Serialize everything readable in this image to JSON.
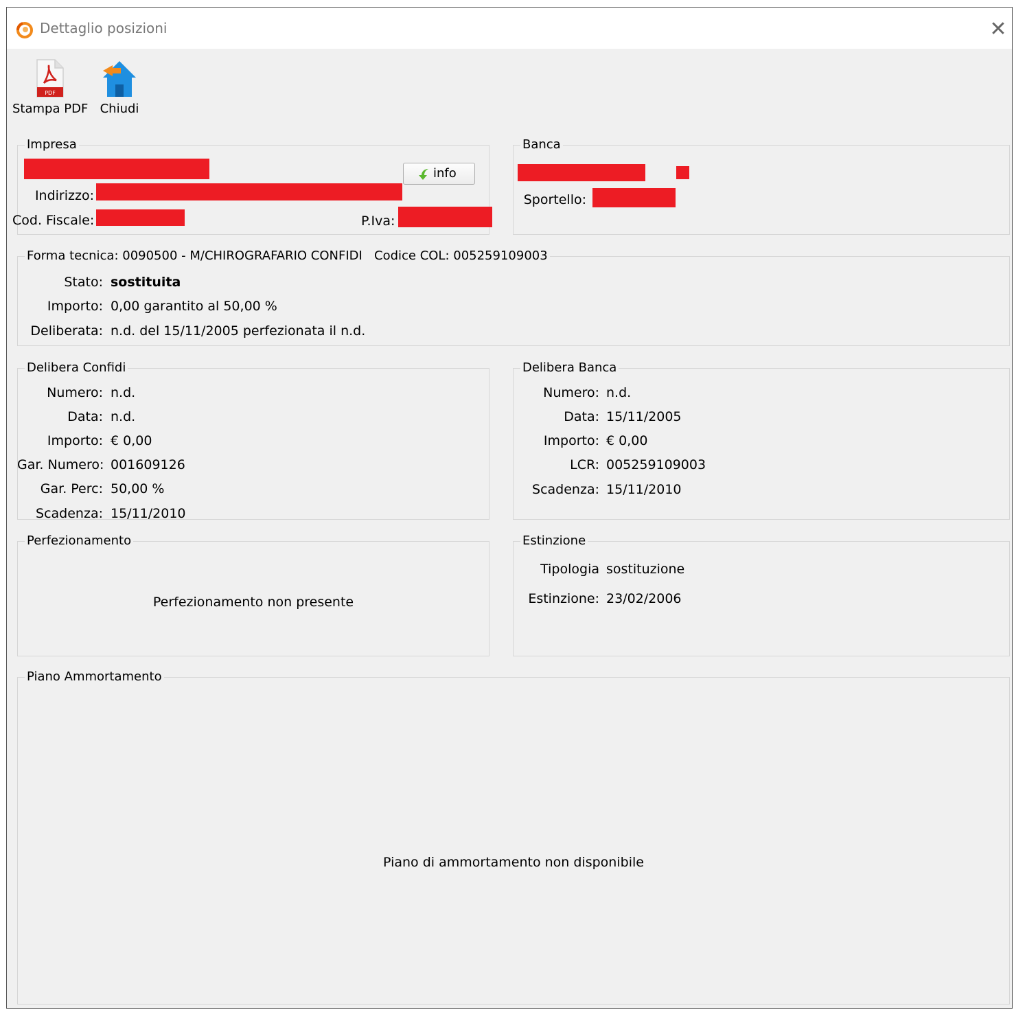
{
  "window": {
    "title": "Dettaglio posizioni",
    "close_glyph": "✕"
  },
  "toolbar": {
    "pdf_label": "Stampa PDF",
    "pdf_icon": "pdf-document-icon",
    "close_label": "Chiudi",
    "close_icon": "home-icon"
  },
  "impresa": {
    "legend": "Impresa",
    "indirizzo_label": "Indirizzo:",
    "cod_fiscale_label": "Cod. Fiscale:",
    "piva_label": "P.Iva:",
    "info_button": "info"
  },
  "banca": {
    "legend": "Banca",
    "sportello_label": "Sportello:"
  },
  "forma": {
    "legend_forma": "Forma tecnica: 0090500 - M/CHIROGRAFARIO CONFIDI",
    "legend_codice": "Codice COL: 005259109003",
    "stato_label": "Stato:",
    "stato_value": "sostituita",
    "importo_label": "Importo:",
    "importo_value": "0,00 garantito al 50,00 %",
    "deliberata_label": "Deliberata:",
    "deliberata_value": "n.d. del 15/11/2005 perfezionata il n.d."
  },
  "delibera_confidi": {
    "legend": "Delibera Confidi",
    "rows": [
      {
        "label": "Numero:",
        "value": "n.d."
      },
      {
        "label": "Data:",
        "value": "n.d."
      },
      {
        "label": "Importo:",
        "value": "€ 0,00"
      },
      {
        "label": "Gar. Numero:",
        "value": "001609126"
      },
      {
        "label": "Gar. Perc:",
        "value": "50,00 %"
      },
      {
        "label": "Scadenza:",
        "value": "15/11/2010"
      }
    ]
  },
  "delibera_banca": {
    "legend": "Delibera Banca",
    "rows": [
      {
        "label": "Numero:",
        "value": "n.d."
      },
      {
        "label": "Data:",
        "value": "15/11/2005"
      },
      {
        "label": "Importo:",
        "value": "€ 0,00"
      },
      {
        "label": "LCR:",
        "value": "005259109003"
      },
      {
        "label": "Scadenza:",
        "value": "15/11/2010"
      }
    ]
  },
  "perfezionamento": {
    "legend": "Perfezionamento",
    "message": "Perfezionamento non presente"
  },
  "estinzione": {
    "legend": "Estinzione",
    "tipologia_label": "Tipologia",
    "tipologia_value": "sostituzione",
    "estinzione_label": "Estinzione:",
    "estinzione_value": "23/02/2006"
  },
  "piano": {
    "legend": "Piano Ammortamento",
    "message": "Piano di ammortamento non disponibile"
  },
  "colors": {
    "redaction": "#ed1c24",
    "background": "#f0f0f0",
    "accent_orange": "#f28a1b"
  }
}
